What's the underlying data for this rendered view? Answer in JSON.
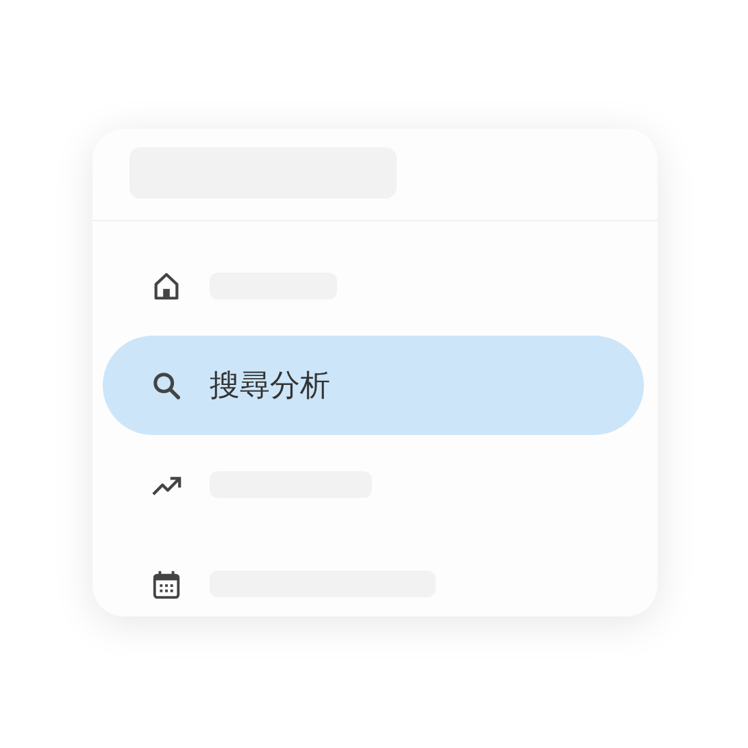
{
  "header": {
    "kind": "placeholder"
  },
  "nav_items": [
    {
      "kind": "placeholder",
      "selected": false
    },
    {
      "kind": "label",
      "label": "搜尋分析",
      "selected": true
    },
    {
      "kind": "placeholder",
      "selected": false
    },
    {
      "kind": "placeholder",
      "selected": false
    }
  ]
}
